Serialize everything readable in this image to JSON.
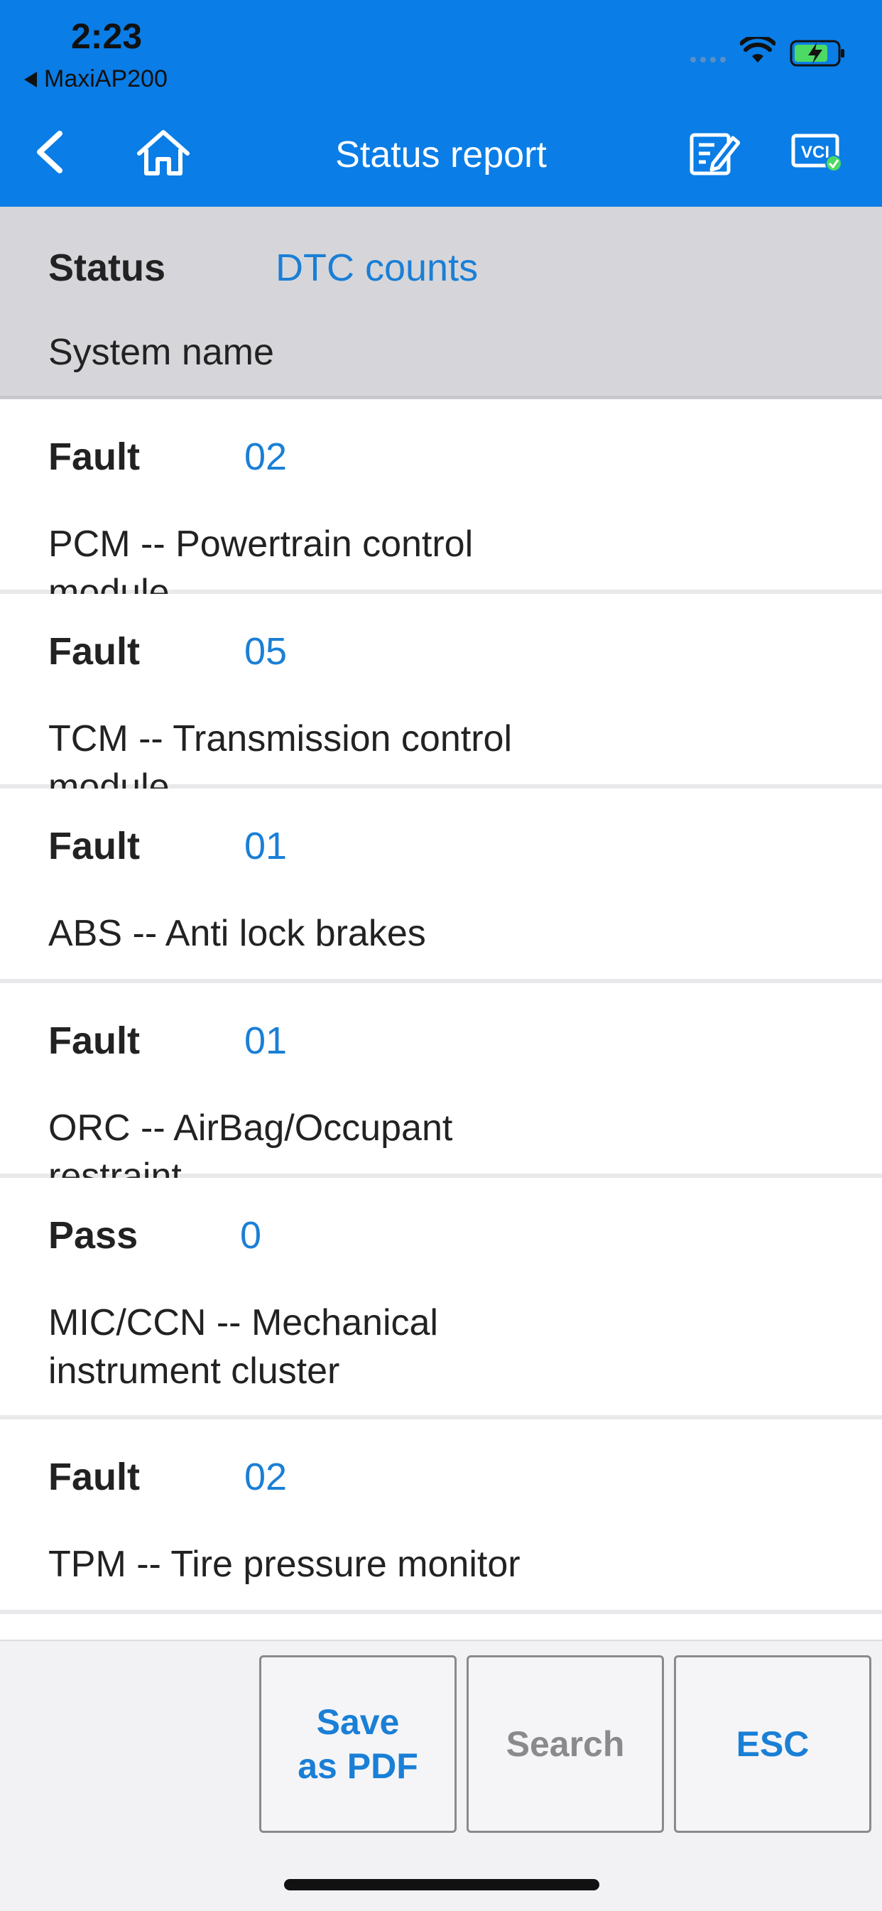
{
  "status_bar": {
    "time": "2:23",
    "back_app": "MaxiAP200"
  },
  "nav": {
    "title": "Status report"
  },
  "header": {
    "status_label": "Status",
    "dtc_label": "DTC counts",
    "system_label": "System name"
  },
  "rows": [
    {
      "status": "Fault",
      "count": "02",
      "system": "PCM -- Powertrain control module"
    },
    {
      "status": "Fault",
      "count": "05",
      "system": "TCM -- Transmission control module"
    },
    {
      "status": "Fault",
      "count": "01",
      "system": "ABS -- Anti lock brakes"
    },
    {
      "status": "Fault",
      "count": "01",
      "system": "ORC -- AirBag/Occupant restraint"
    },
    {
      "status": "Pass",
      "count": "0",
      "system_line1": "MIC/CCN -- Mechanical",
      "system_line2": "instrument cluster"
    },
    {
      "status": "Fault",
      "count": "02",
      "system": "TPM -- Tire pressure monitor"
    }
  ],
  "toolbar": {
    "save_line1": "Save",
    "save_line2": "as PDF",
    "search": "Search",
    "esc": "ESC"
  },
  "colors": {
    "nav_bg": "#0a7de6",
    "accent": "#1a7fd6",
    "header_bg": "#d6d6da",
    "battery_fill": "#4cd964"
  },
  "icons": {
    "back": "chevron-left-icon",
    "home": "home-icon",
    "edit": "edit-icon",
    "vci": "vci-connected-icon",
    "wifi": "wifi-icon",
    "battery": "battery-charging-icon"
  }
}
